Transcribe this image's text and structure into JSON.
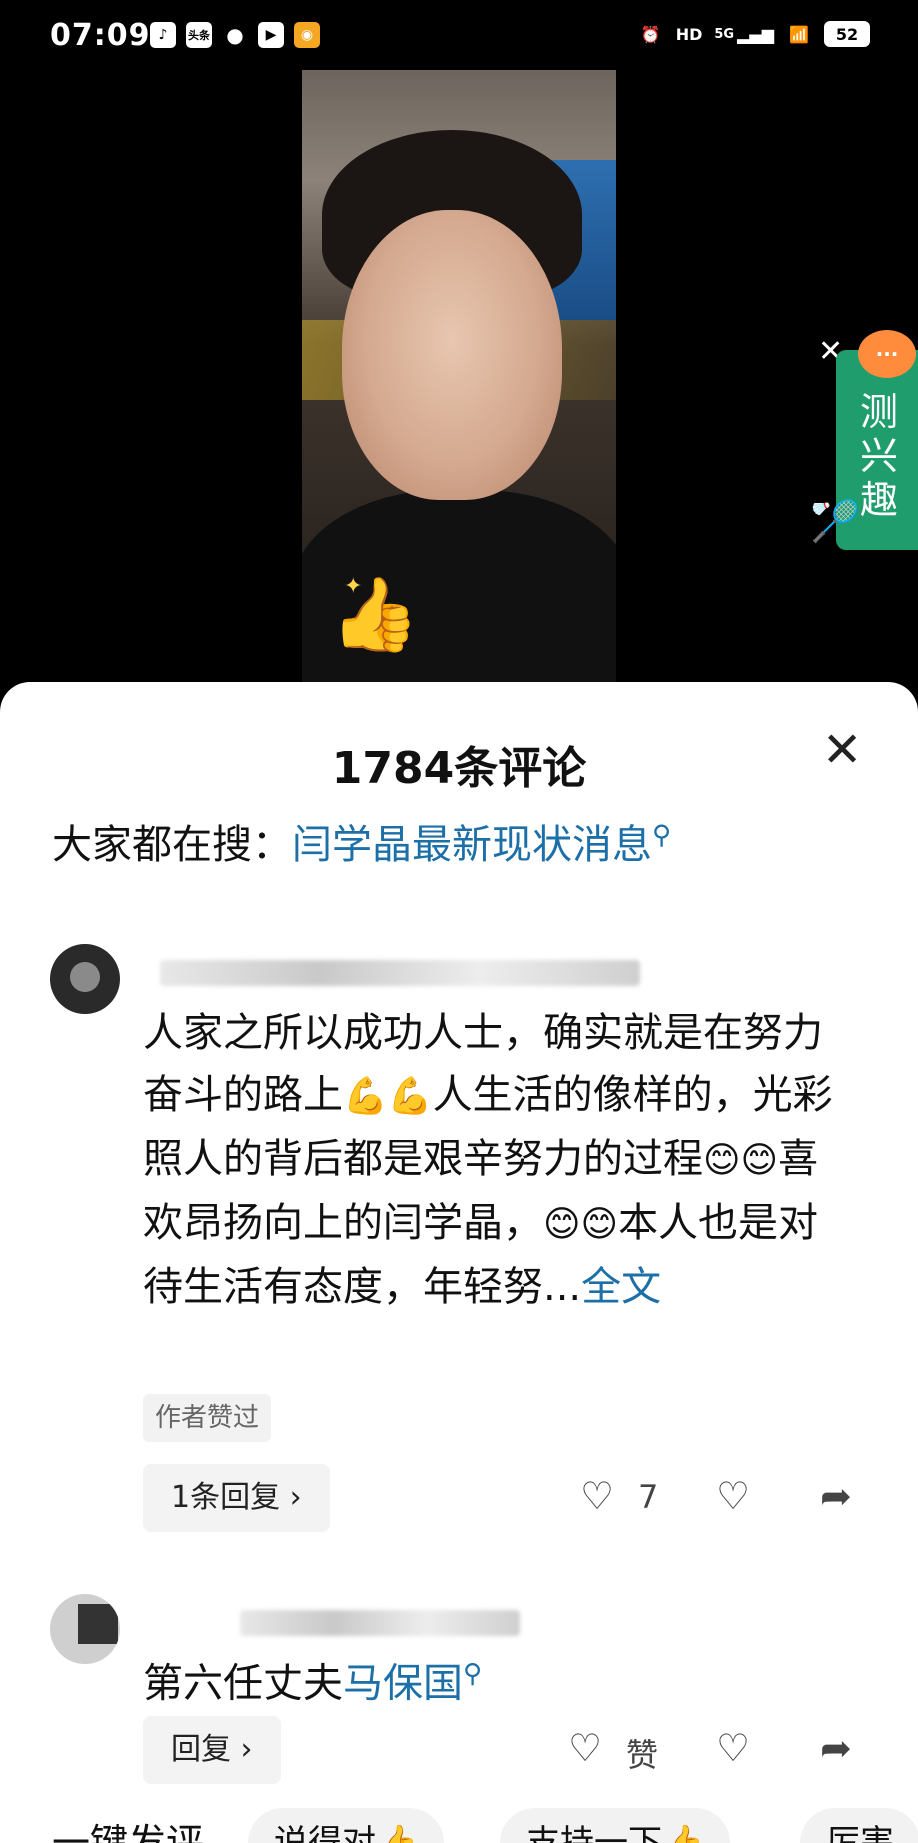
{
  "status_bar": {
    "time": "07:09",
    "app_icons": [
      "tiktok-icon",
      "toutiao-icon",
      "wechat-icon",
      "video-icon",
      "weibo-icon"
    ],
    "toutiao_text": "头条",
    "network": "5G",
    "hd": "HD",
    "battery": "52"
  },
  "side_widget": {
    "label": "测兴趣",
    "close": "✕"
  },
  "comments_sheet": {
    "title": "1784条评论",
    "close": "✕",
    "search_prefix": "大家都在搜：",
    "search_link": "闫学晶最新现状消息",
    "comments": [
      {
        "text_1": "人家之所以成功人士，确实就是在努力奋斗的路上",
        "text_2": "人生活的像样的，光彩照人的背后都是艰辛努力的过程",
        "text_3": "喜欢昂扬向上的闫学晶，",
        "text_4": "本人也是对待生活有态度，年轻努...",
        "fulltext": "全文",
        "author_liked": "作者赞过",
        "reply": "1条回复 ›",
        "likes": "7"
      },
      {
        "text": "第六任丈夫",
        "link": "马保国",
        "reply": "回复 ›",
        "likes": "赞"
      }
    ]
  },
  "quick_reply": {
    "label": "一键发评",
    "chips": [
      "说得对👍",
      "支持一下👍",
      "厉害"
    ]
  }
}
